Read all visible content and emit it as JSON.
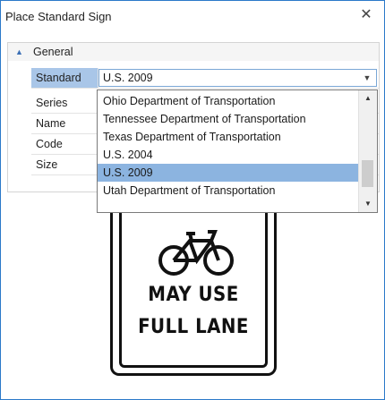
{
  "window": {
    "title": "Place Standard Sign",
    "close_glyph": "✕"
  },
  "grid": {
    "category": "General",
    "rows": [
      {
        "label": "Standard",
        "value": "U.S. 2009"
      },
      {
        "label": "Series",
        "value": ""
      },
      {
        "label": "Name",
        "value": ""
      },
      {
        "label": "Code",
        "value": ""
      },
      {
        "label": "Size",
        "value": ""
      }
    ]
  },
  "dropdown": {
    "options": [
      "Ohio Department of Transportation",
      "Tennessee Department of Transportation",
      "Texas Department of Transportation",
      "U.S. 2004",
      "U.S. 2009",
      "Utah Department of Transportation"
    ],
    "selected": "U.S. 2009"
  },
  "sign": {
    "line1": "MAY USE",
    "line2": "FULL LANE"
  }
}
